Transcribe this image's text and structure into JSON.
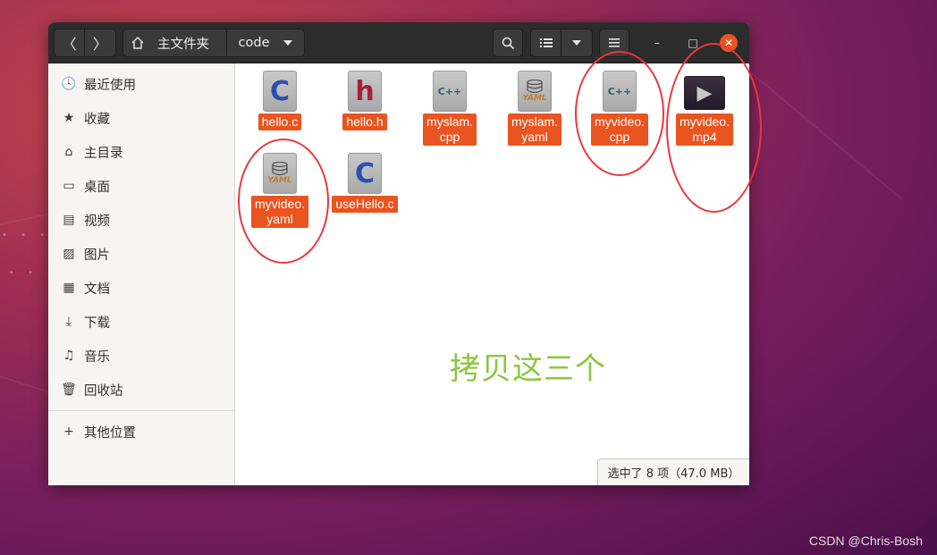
{
  "desktop": {
    "watermark": "CSDN @Chris-Bosh"
  },
  "headerbar": {
    "back_icon": "〈",
    "forward_icon": "〉",
    "home_label": "主文件夹",
    "current_folder": "code",
    "search_icon": "search-icon",
    "view_icon": "list-view-icon",
    "menu_icon": "hamburger-menu-icon",
    "minimize": "–",
    "maximize": "□",
    "close": "✕"
  },
  "sidebar": {
    "items": [
      {
        "icon": "🕓",
        "label": "最近使用"
      },
      {
        "icon": "★",
        "label": "收藏"
      },
      {
        "icon": "⌂",
        "label": "主目录"
      },
      {
        "icon": "▭",
        "label": "桌面"
      },
      {
        "icon": "▤",
        "label": "视频"
      },
      {
        "icon": "▨",
        "label": "图片"
      },
      {
        "icon": "▦",
        "label": "文档"
      },
      {
        "icon": "⤓",
        "label": "下载"
      },
      {
        "icon": "♫",
        "label": "音乐"
      },
      {
        "icon": "🗑",
        "label": "回收站"
      }
    ],
    "other_locations": {
      "icon": "+",
      "label": "其他位置"
    }
  },
  "files": [
    {
      "name": "hello.c",
      "type": "c",
      "glyph": "C"
    },
    {
      "name": "hello.h",
      "type": "h",
      "glyph": "h"
    },
    {
      "name": "myslam.\ncpp",
      "type": "cpp",
      "glyph": "C++"
    },
    {
      "name": "myslam.\nyaml",
      "type": "yaml",
      "glyph": "YAML"
    },
    {
      "name": "myvideo.\ncpp",
      "type": "cpp",
      "glyph": "C++"
    },
    {
      "name": "myvideo.\nmp4",
      "type": "video",
      "glyph": "▶"
    },
    {
      "name": "myvideo.\nyaml",
      "type": "yaml",
      "glyph": "YAML"
    },
    {
      "name": "useHello.c",
      "type": "c",
      "glyph": "C"
    }
  ],
  "annotation_text": "拷贝这三个",
  "status": "选中了 8 项（47.0 MB）",
  "colors": {
    "accent": "#e95420",
    "annotation": "#8cc63f",
    "highlight_circle": "#e8383c"
  }
}
